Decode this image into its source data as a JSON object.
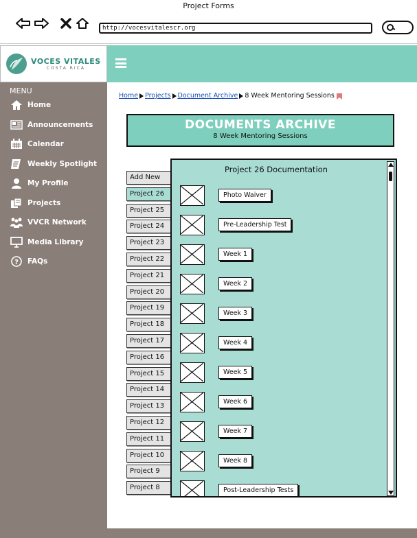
{
  "window": {
    "title": "Project Forms",
    "url": "http://vocesvitalescr.org"
  },
  "logo": {
    "name": "VOCES VITALES",
    "sub": "COSTA RICA"
  },
  "sidebar": {
    "menu_title": "MENU",
    "items": [
      {
        "label": "Home",
        "icon": "home-icon"
      },
      {
        "label": "Announcements",
        "icon": "announcements-icon"
      },
      {
        "label": "Calendar",
        "icon": "calendar-icon"
      },
      {
        "label": "Weekly Spotlight",
        "icon": "spotlight-icon"
      },
      {
        "label": "My Profile",
        "icon": "profile-icon"
      },
      {
        "label": "Projects",
        "icon": "projects-icon"
      },
      {
        "label": "VVCR Network",
        "icon": "network-icon"
      },
      {
        "label": "Media Library",
        "icon": "media-icon"
      },
      {
        "label": "FAQs",
        "icon": "faq-icon"
      }
    ]
  },
  "breadcrumb": {
    "items": [
      "Home",
      "Projects",
      "Document Archive"
    ],
    "current": "8 Week Mentoring Sessions"
  },
  "archive": {
    "title": "DOCUMENTS ARCHIVE",
    "subtitle": "8 Week Mentoring Sessions"
  },
  "tabs": [
    "Add New",
    "Project 26",
    "Project 25",
    "Project 24",
    "Project 23",
    "Project 22",
    "Project 21",
    "Project 20",
    "Project 19",
    "Project 18",
    "Project 17",
    "Project 16",
    "Project 15",
    "Project 14",
    "Project 13",
    "Project 12",
    "Project 11",
    "Project 10",
    "Project 9",
    "Project 8"
  ],
  "active_tab": "Project 26",
  "panel": {
    "title": "Project 26 Documentation",
    "documents": [
      "Photo Waiver",
      "Pre-Leadership Test",
      "Week 1",
      "Week 2",
      "Week 3",
      "Week 4",
      "Week 5",
      "Week 6",
      "Week 7",
      "Week 8",
      "Post-Leadership Tests"
    ]
  },
  "colors": {
    "accent": "#7ecfbd",
    "panel": "#a9ddd3",
    "sidebar": "#8a7e78",
    "link": "#1a4fb3"
  }
}
